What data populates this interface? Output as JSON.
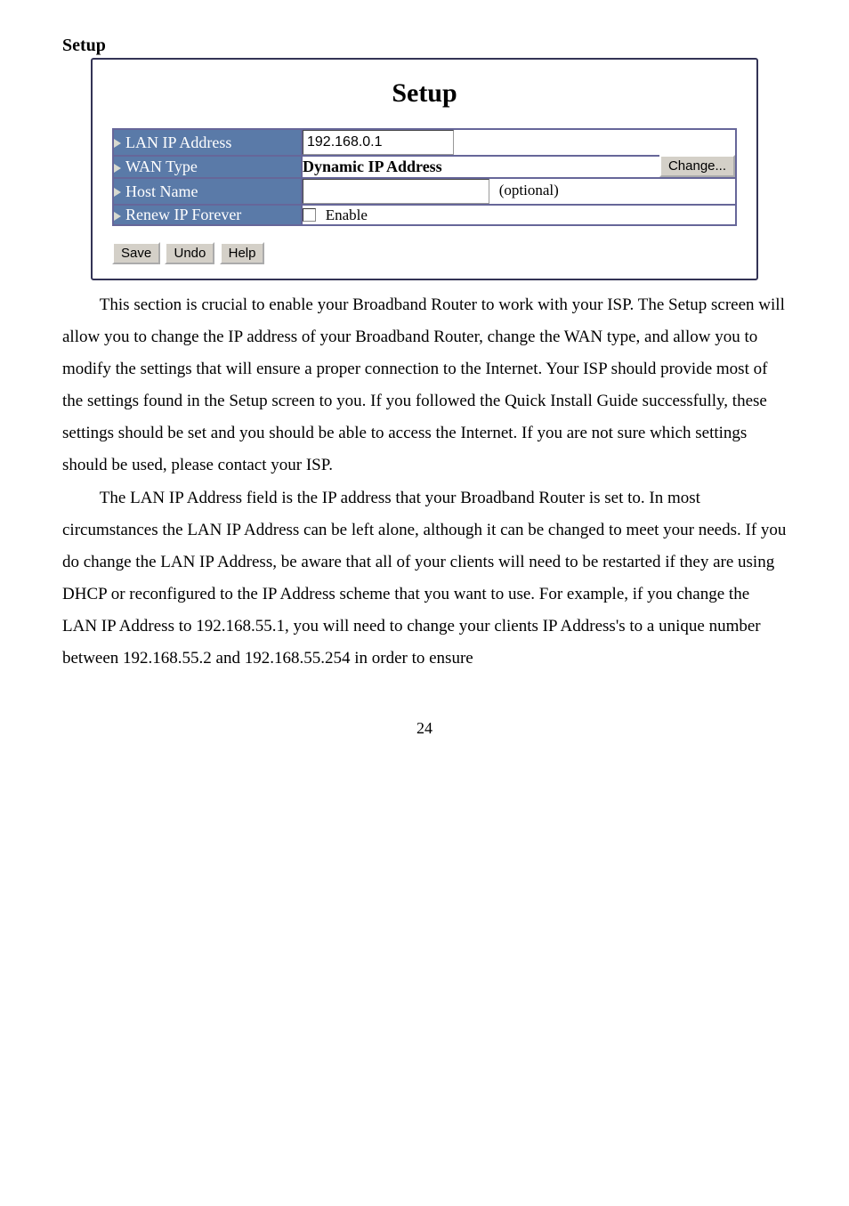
{
  "heading": "Setup",
  "setup_panel": {
    "title": "Setup",
    "rows": {
      "lan_ip": {
        "label": "LAN IP Address",
        "value": "192.168.0.1"
      },
      "wan_type": {
        "label": "WAN Type",
        "value": "Dynamic IP Address",
        "button": "Change..."
      },
      "host_name": {
        "label": "Host Name",
        "value": "",
        "optional": "(optional)"
      },
      "renew_ip": {
        "label": "Renew IP Forever",
        "checkbox_label": "Enable",
        "checked": false
      }
    },
    "buttons": {
      "save": "Save",
      "undo": "Undo",
      "help": "Help"
    }
  },
  "paragraphs": {
    "p1": "This section is crucial to enable your Broadband Router to work with your ISP. The Setup screen will allow you to change the IP address of your Broadband Router, change the WAN type, and allow you to modify the settings that will ensure a proper connection to the Internet. Your ISP should provide most of the settings found in the Setup screen to you. If you followed the Quick Install Guide successfully, these settings should be set and you should be able to access the Internet. If you are not sure which settings should be used, please contact your ISP.",
    "p2": "The LAN IP Address field is the IP address that your Broadband Router is set to. In most circumstances the LAN IP Address can be left alone, although it can be changed to meet your needs. If you do change the LAN IP Address, be aware that all of your clients will need to be restarted if they are using DHCP or reconfigured to the IP Address scheme that you want to use. For example, if you change the LAN IP Address to 192.168.55.1, you will need to change your clients IP Address's to a unique number between 192.168.55.2 and 192.168.55.254 in order to ensure"
  },
  "page_number": "24"
}
